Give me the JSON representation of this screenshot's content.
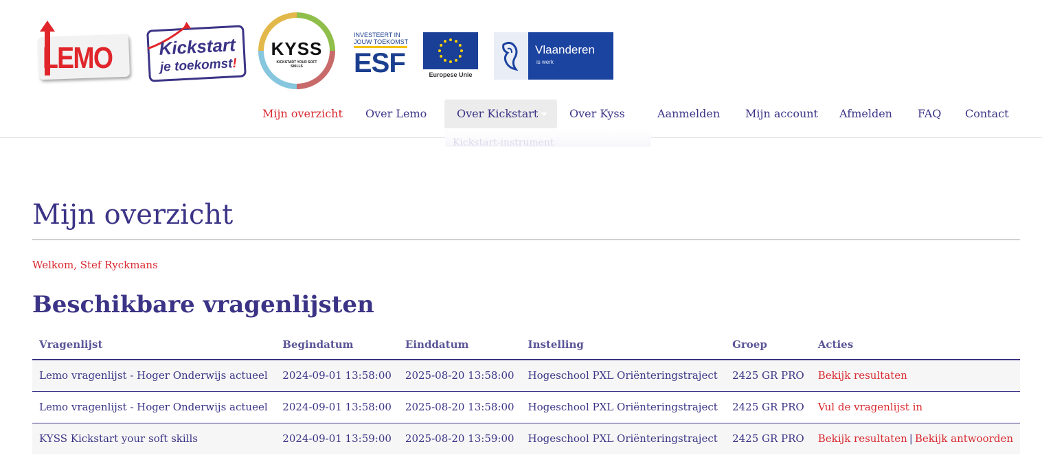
{
  "logos": {
    "lemo": "LEMO",
    "kickstart_line1": "Kickstart",
    "kickstart_line2": "je toekomst",
    "kickstart_excl": "!",
    "kyss_title": "KYSS",
    "kyss_sub": "KICKSTART YOUR SOFT SKILLS",
    "esf_line1": "INVESTEERT IN",
    "esf_line2": "JOUW TOEKOMST",
    "esf_big": "ESF",
    "eu_label": "Europese Unie",
    "vlaanderen": "Vlaanderen",
    "vlaanderen_sub": "is werk"
  },
  "nav": {
    "items": [
      {
        "label": "Mijn overzicht"
      },
      {
        "label": "Over Lemo"
      },
      {
        "label": "Over Kickstart"
      },
      {
        "label": "Over Kyss"
      },
      {
        "label": "Aanmelden"
      },
      {
        "label": "Mijn account"
      },
      {
        "label": "Afmelden"
      },
      {
        "label": "FAQ"
      },
      {
        "label": "Contact"
      }
    ],
    "dropdown_item": "Kickstart-instrument"
  },
  "page": {
    "title": "Mijn overzicht",
    "welcome": "Welkom, Stef Ryckmans",
    "section_title": "Beschikbare vragenlijsten"
  },
  "table": {
    "headers": [
      "Vragenlijst",
      "Begindatum",
      "Einddatum",
      "Instelling",
      "Groep",
      "Acties"
    ],
    "rows": [
      {
        "vragenlijst": "Lemo vragenlijst - Hoger Onderwijs actueel",
        "begindatum": "2024-09-01 13:58:00",
        "einddatum": "2025-08-20 13:58:00",
        "instelling": "Hogeschool PXL Oriënteringstraject",
        "groep": "2425 GR PRO",
        "actions": [
          "Bekijk resultaten"
        ]
      },
      {
        "vragenlijst": "Lemo vragenlijst - Hoger Onderwijs actueel",
        "begindatum": "2024-09-01 13:58:00",
        "einddatum": "2025-08-20 13:58:00",
        "instelling": "Hogeschool PXL Oriënteringstraject",
        "groep": "2425 GR PRO",
        "actions": [
          "Vul de vragenlijst in"
        ]
      },
      {
        "vragenlijst": "KYSS Kickstart your soft skills",
        "begindatum": "2024-09-01 13:59:00",
        "einddatum": "2025-08-20 13:59:00",
        "instelling": "Hogeschool PXL Oriënteringstraject",
        "groep": "2425 GR PRO",
        "actions": [
          "Bekijk resultaten",
          "Bekijk antwoorden"
        ],
        "separator": "|"
      }
    ]
  },
  "colors": {
    "brand": "#3b3486",
    "accent": "#d8292f"
  }
}
